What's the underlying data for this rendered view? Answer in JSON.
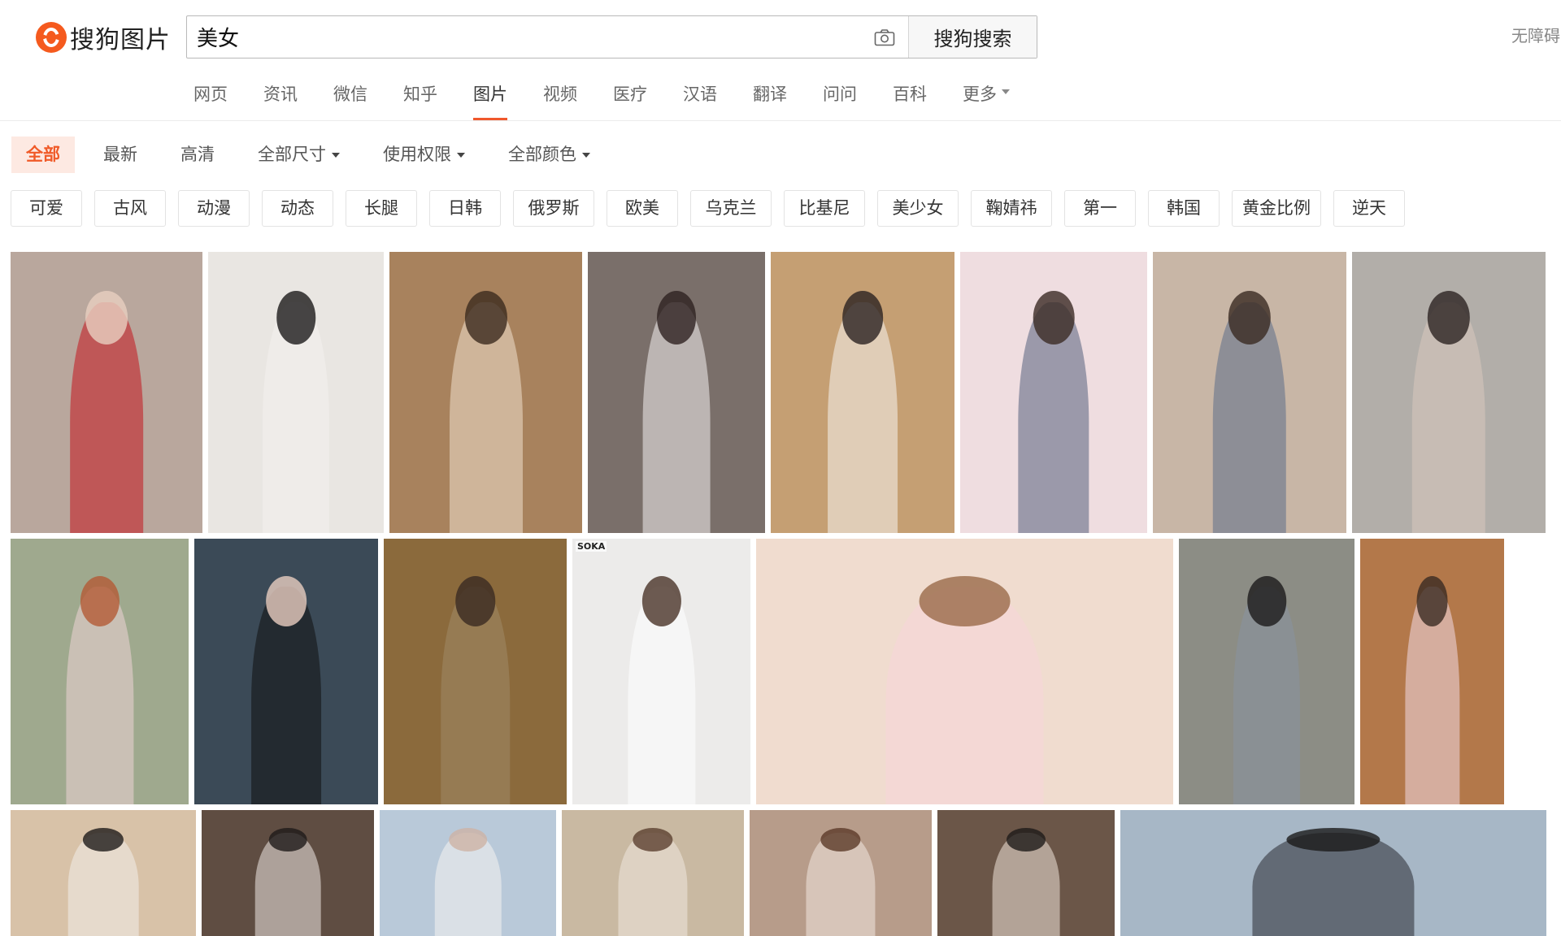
{
  "header": {
    "logo_text": "搜狗图片",
    "search_value": "美女",
    "search_button": "搜狗搜索",
    "accessibility_link": "无障碍"
  },
  "nav": {
    "tabs": [
      {
        "label": "网页",
        "active": false
      },
      {
        "label": "资讯",
        "active": false
      },
      {
        "label": "微信",
        "active": false
      },
      {
        "label": "知乎",
        "active": false
      },
      {
        "label": "图片",
        "active": true
      },
      {
        "label": "视频",
        "active": false
      },
      {
        "label": "医疗",
        "active": false
      },
      {
        "label": "汉语",
        "active": false
      },
      {
        "label": "翻译",
        "active": false
      },
      {
        "label": "问问",
        "active": false
      },
      {
        "label": "百科",
        "active": false
      }
    ],
    "more_label": "更多"
  },
  "filters": {
    "items": [
      {
        "label": "全部",
        "active": true,
        "dropdown": false
      },
      {
        "label": "最新",
        "active": false,
        "dropdown": false
      },
      {
        "label": "高清",
        "active": false,
        "dropdown": false
      },
      {
        "label": "全部尺寸",
        "active": false,
        "dropdown": true
      },
      {
        "label": "使用权限",
        "active": false,
        "dropdown": true
      },
      {
        "label": "全部颜色",
        "active": false,
        "dropdown": true
      }
    ]
  },
  "tags": [
    "可爱",
    "古风",
    "动漫",
    "动态",
    "长腿",
    "日韩",
    "俄罗斯",
    "欧美",
    "乌克兰",
    "比基尼",
    "美少女",
    "鞠婧祎",
    "第一",
    "韩国",
    "黄金比例",
    "逆天"
  ],
  "thumbnails": {
    "row1": [
      {
        "bg": "#b9a79d",
        "fig": "#c4161e",
        "head": "#e9cfc0"
      },
      {
        "bg": "#e9e6e2",
        "fig": "#f4f1ee",
        "head": "#1c1a1a"
      },
      {
        "bg": "#a8825d",
        "fig": "#efe0cc",
        "head": "#3b2a1e"
      },
      {
        "bg": "#7a6f6a",
        "fig": "#f2efee",
        "head": "#2e2220"
      },
      {
        "bg": "#c59f73",
        "fig": "#f5f2ef",
        "head": "#2b2220"
      },
      {
        "bg": "#efdde0",
        "fig": "#55607e",
        "head": "#3b2a24"
      },
      {
        "bg": "#c8b6a6",
        "fig": "#5c6e88",
        "head": "#3a2a22"
      },
      {
        "bg": "#b2aea9",
        "fig": "#d9c9bd",
        "head": "#2c2322"
      }
    ],
    "row2": [
      {
        "bg": "#9fa98e",
        "fig": "#ecd3d6",
        "head": "#b35a36"
      },
      {
        "bg": "#3b4a57",
        "fig": "#111111",
        "head": "#e9cdc0"
      },
      {
        "bg": "#8b6a3c",
        "fig": "#a18866",
        "head": "#3a2a22"
      },
      {
        "bg": "#ecebea",
        "fig": "#ffffff",
        "head": "#4a3328"
      },
      {
        "bg": "#f0dccf",
        "fig": "#f7d6da",
        "head": "#9a6a48"
      },
      {
        "bg": "#8c8d85",
        "fig": "#8894a0",
        "head": "#1c1a1a"
      },
      {
        "bg": "#b3784a",
        "fig": "#f1d9e4",
        "head": "#3a2a22"
      }
    ],
    "row3": [
      {
        "bg": "#d8c2a8",
        "fig": "#f3efea",
        "head": "#1e1a19"
      },
      {
        "bg": "#5f4d42",
        "fig": "#ece8e4",
        "head": "#1e1a19"
      },
      {
        "bg": "#b9c9d9",
        "fig": "#f6f2f0",
        "head": "#cdb3a5"
      },
      {
        "bg": "#c9b9a2",
        "fig": "#efe7de",
        "head": "#5b4030"
      },
      {
        "bg": "#b79c8a",
        "fig": "#f2e8e0",
        "head": "#5b3a28"
      },
      {
        "bg": "#6b5648",
        "fig": "#efe3d8",
        "head": "#1e1a19"
      },
      {
        "bg": "#a7b7c6",
        "fig": "#2a2b33",
        "head": "#1c1a1a"
      }
    ],
    "soka_label": "SOKA"
  }
}
